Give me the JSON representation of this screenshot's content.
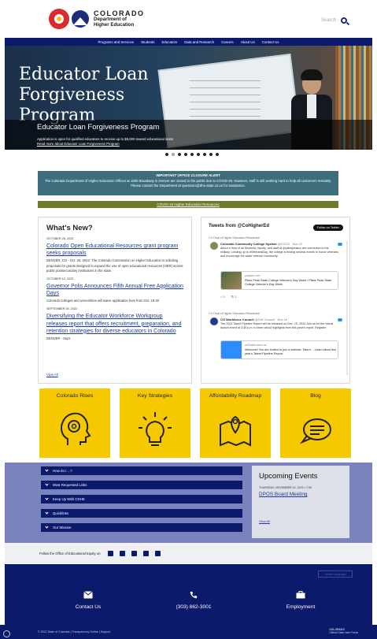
{
  "header": {
    "logo_title": "COLORADO",
    "logo_line1": "Department of",
    "logo_line2": "Higher Education",
    "search_label": "Search"
  },
  "nav": [
    "Programs and Services",
    "Students",
    "Educators",
    "Data and Research",
    "Careers",
    "About Us",
    "Contact Us"
  ],
  "hero": {
    "title_line1": "Educator Loan",
    "title_line2": "Forgiveness",
    "title_line3": "Program",
    "subtitle": "Educator Loan Forgiveness Program",
    "description": "Application is open for qualified educators to receive up to $5,000 toward educational loans",
    "link": "Read more about Educator Loan Forgiveness Program",
    "slide_count": 9,
    "active_slide": 1
  },
  "alert": {
    "title": "IMPORTANT OFFICE CLOSURE ALERT",
    "body": "The Colorado Department of Higher Education Offices at 1600 Broadway in Denver are closed to the public due to COVID-19. However, staff is still working hard to help all customers remotely. Please contact the Department at questions@dhe.state.co.us for assistance."
  },
  "covid_link": "COVID-19 Higher Education Resources",
  "news": {
    "heading": "What's New?",
    "items": [
      {
        "date": "OCTOBER 26, 2022",
        "title": "Colorado Open Educational Resources grant program seeks proposals",
        "body": "DENVER, CO - Oct. 26, 2022: The Colorado Commission on Higher Education is soliciting proposals for grants designed to expand the use of open educational resources (OER) across public postsecondary institutions in the state."
      },
      {
        "date": "OCTOBER 12, 2022",
        "title": "Governor Polis Announces Fifth Annual Free Application Days",
        "body": "Colorado colleges and universities will waive application fees from Oct. 18-20"
      },
      {
        "date": "SEPTEMBER 30, 2022",
        "title": "Diversifying the Educator Workforce Workgroup releases report that offers recruitment, preparation, and retention strategies for diverse educators in Colorado",
        "body": "DENVER - Sept."
      }
    ],
    "view_all": "View All"
  },
  "tweets": {
    "heading": "Tweets from @CoHigherEd",
    "follow_label": "Follow on Twitter",
    "items": [
      {
        "retweet": "CO Dept of Higher Education Retweeted",
        "name": "Colorado Community College System",
        "handle": "@CCCS · Nov 10",
        "text": "About a third of all Students, faculty, and staff at @pikespeakcc are connected to the military. Leading up to #VeteransDay, the college is finding several events to honor veterans and encourage the wider veteran community.",
        "card_domain": "youtube.com",
        "card_text": "Pikes Peak State College Veteran's Day Week / Pikes Peak State College Veteran's Day Week",
        "replies": "0",
        "retweets": "2"
      },
      {
        "retweet": "CO Dept of Higher Education Retweeted",
        "name": "CO Workforce Council",
        "handle": "@CW Council · Nov 10",
        "text": "The 2022 Talent Pipeline Report will be released on Dec. 15, 2022 Join us for the virtual launch event at 3:30 p.m. to learn about highlights from this year's report. Register:",
        "card_domain": "us02web.zoom.us",
        "card_text": "Welcome! You are invited to join a webinar: Talent ... Learn about this year's Talent Pipeline Report."
      }
    ]
  },
  "tiles": [
    "Colorado Rises",
    "Key Strategies",
    "Affordability Roadmap",
    "Blog"
  ],
  "accordions": [
    "How do I ...?",
    "Most Requested Links",
    "Keep Up With CDHE",
    "Quicklinks",
    "Our Mission"
  ],
  "events": {
    "heading": "Upcoming Events",
    "date": "THURSDAY, NOVEMBER 10, 2022 • 7:00",
    "title": "DPOS Board Meeting",
    "view_all": "View All"
  },
  "equity": {
    "text": "Follow the Office of Educational Equity on:"
  },
  "footer": {
    "translate_label": "Select Language",
    "contact": "Contact Us",
    "phone": "(303) 862-3001",
    "employment": "Employment",
    "copyright": "© 2022 State of Colorado | Transparency Online | Support",
    "state_logo_line1": "COLORADO",
    "state_logo_line2": "Official State Web Portal"
  },
  "colors": {
    "navy": "#0b1a6b",
    "teal_alert": "#3e6e7e",
    "olive": "#6f7a2c",
    "yellow": "#f6c800",
    "band": "#7a83bd"
  }
}
